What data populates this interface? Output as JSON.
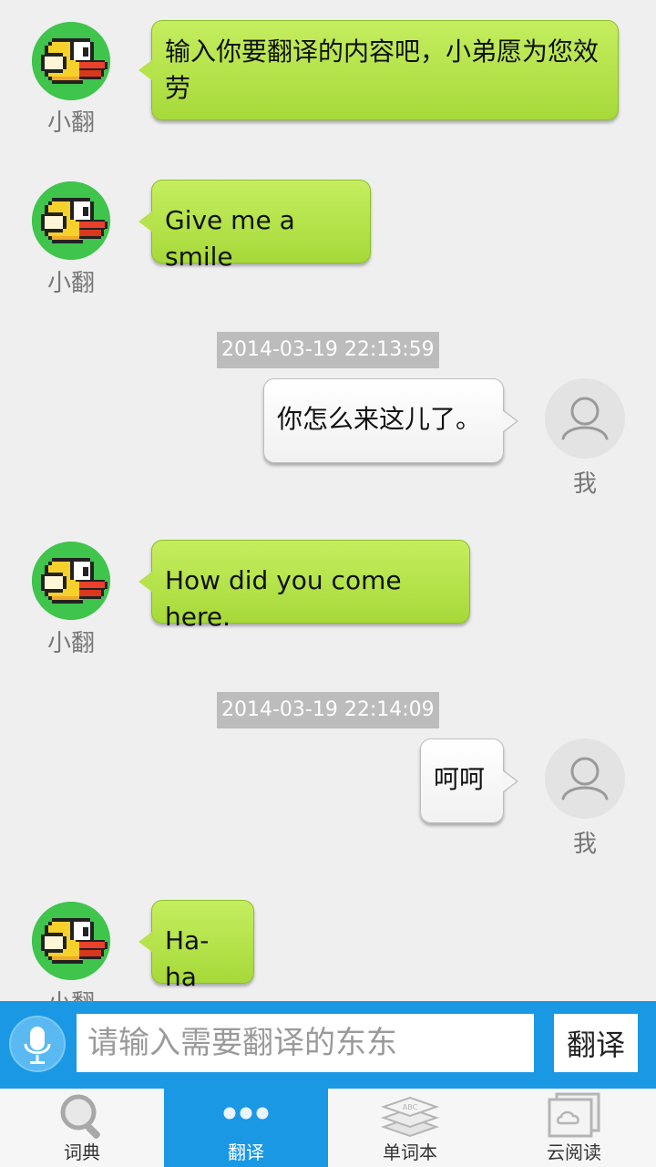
{
  "messages": [
    {
      "sender": "bot",
      "nick": "小翻",
      "text": "输入你要翻译的内容吧，小弟愿为您效劳"
    },
    {
      "sender": "bot",
      "nick": "小翻",
      "text": "Give me a smile"
    },
    {
      "type": "timestamp",
      "text": "2014-03-19 22:13:59"
    },
    {
      "sender": "me",
      "nick": "我",
      "text": "你怎么来这儿了。"
    },
    {
      "sender": "bot",
      "nick": "小翻",
      "text": "How did you come here."
    },
    {
      "type": "timestamp",
      "text": "2014-03-19 22:14:09"
    },
    {
      "sender": "me",
      "nick": "我",
      "text": "呵呵"
    },
    {
      "sender": "bot",
      "nick": "小翻",
      "text": "Ha-ha"
    }
  ],
  "input": {
    "placeholder": "请输入需要翻译的东东",
    "value": "",
    "translate_label": "翻译"
  },
  "tabs": [
    {
      "label": "词典",
      "icon": "magnifier-icon",
      "active": false
    },
    {
      "label": "翻译",
      "icon": "dots-icon",
      "active": true
    },
    {
      "label": "单词本",
      "icon": "word-book-icon",
      "active": false
    },
    {
      "label": "云阅读",
      "icon": "cloud-reader-icon",
      "active": false
    }
  ],
  "colors": {
    "accent": "#1a98e3",
    "bot_bubble": "#b6e34c",
    "me_bubble": "#f6f6f6",
    "background": "#efefef"
  }
}
